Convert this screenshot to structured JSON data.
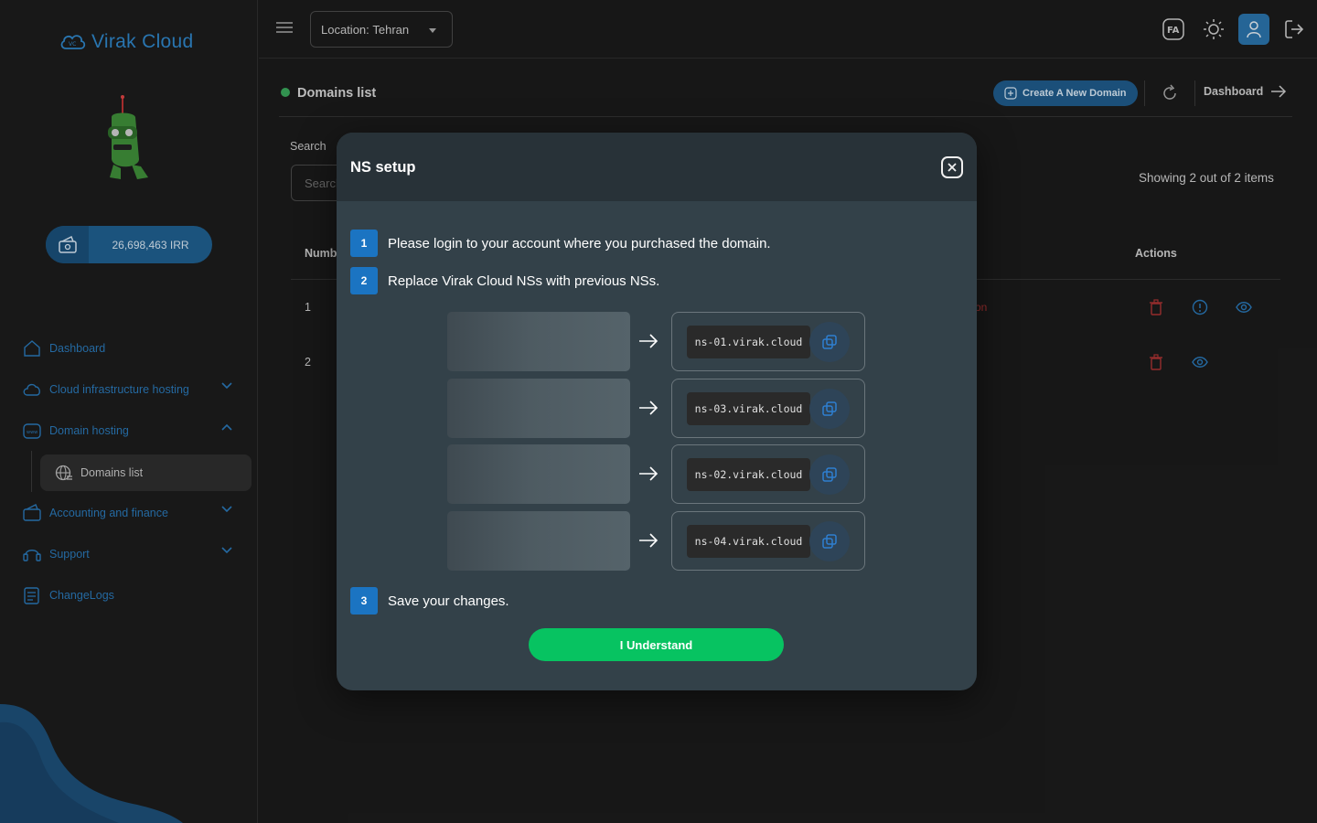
{
  "sidebar": {
    "logo_text": "Virak Cloud",
    "wallet_amount": "26,698,463 IRR",
    "nav": {
      "dashboard": "Dashboard",
      "cloud": "Cloud infrastructure hosting",
      "domain": "Domain hosting",
      "domains_list": "Domains list",
      "accounting": "Accounting and finance",
      "support": "Support",
      "changelogs": "ChangeLogs"
    }
  },
  "topbar": {
    "location_label": "Location:",
    "location_value": "Tehran",
    "lang": "FA"
  },
  "header": {
    "title": "Domains list",
    "create_label": "Create A New Domain",
    "dashboard_label": "Dashboard"
  },
  "list": {
    "search_label": "Search",
    "search_placeholder": "Search",
    "showing": "Showing 2 out of 2 items",
    "col_number": "Number",
    "col_actions": "Actions",
    "rows": [
      "1",
      "2"
    ],
    "row1_status_fragment": "on"
  },
  "modal": {
    "title": "NS setup",
    "step1_num": "1",
    "step1_text": "Please login to your account where you purchased the domain.",
    "step2_num": "2",
    "step2_text": "Replace Virak Cloud NSs with previous NSs.",
    "step3_num": "3",
    "step3_text": "Save your changes.",
    "nameservers": [
      "ns-01.virak.cloud",
      "ns-03.virak.cloud",
      "ns-02.virak.cloud",
      "ns-04.virak.cloud"
    ],
    "button_label": "I Understand"
  },
  "colors": {
    "accent": "#2b74ab",
    "success": "#07c361",
    "danger": "#a33333"
  }
}
